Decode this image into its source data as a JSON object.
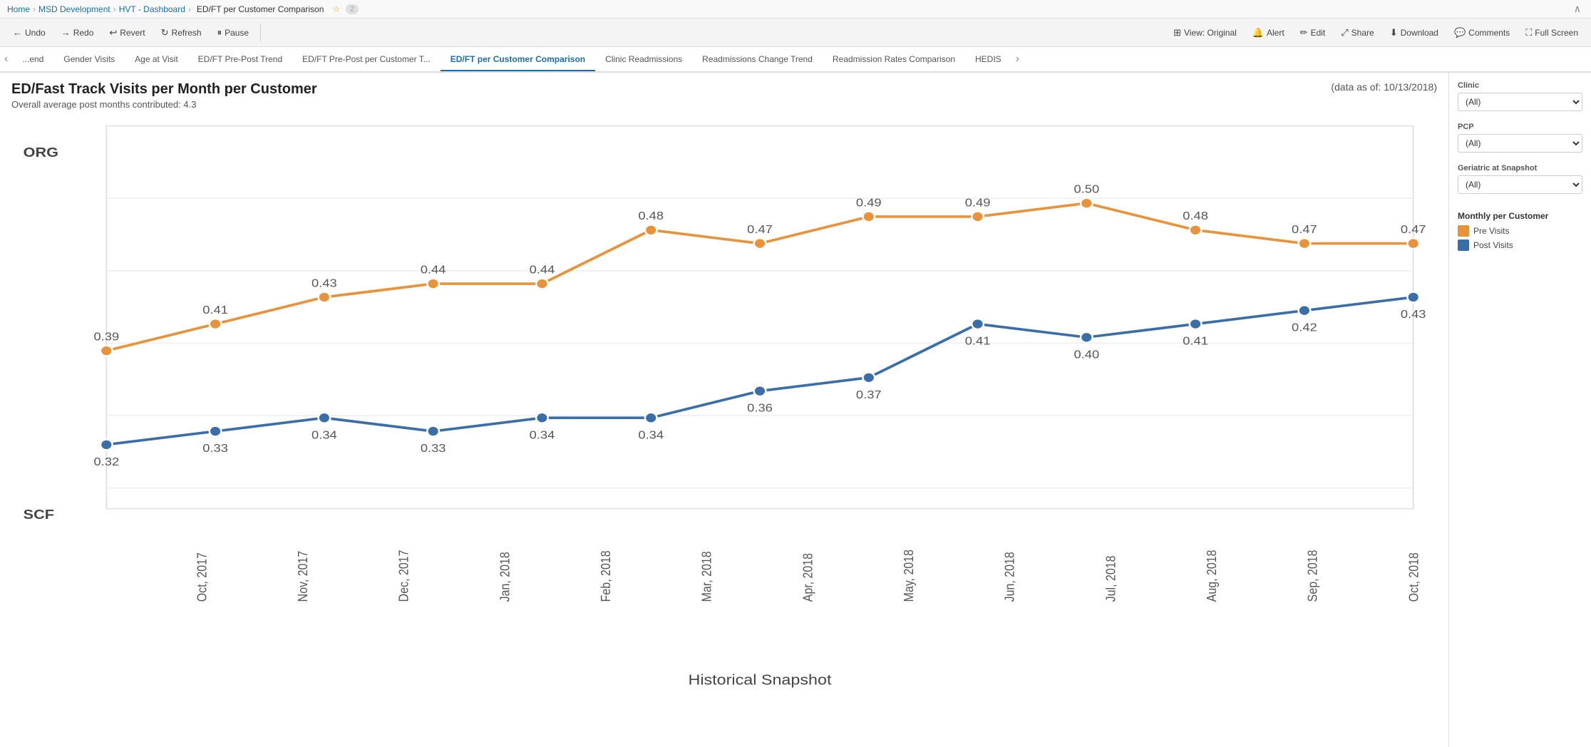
{
  "breadcrumb": {
    "home": "Home",
    "msd": "MSD Development",
    "hvt": "HVT - Dashboard",
    "current": "ED/FT per Customer Comparison",
    "count": "2"
  },
  "toolbar": {
    "undo_label": "Undo",
    "redo_label": "Redo",
    "revert_label": "Revert",
    "refresh_label": "Refresh",
    "pause_label": "Pause",
    "view_label": "View: Original",
    "alert_label": "Alert",
    "edit_label": "Edit",
    "share_label": "Share",
    "download_label": "Download",
    "comments_label": "Comments",
    "fullscreen_label": "Full Screen"
  },
  "tabs": [
    {
      "label": "...end",
      "active": false
    },
    {
      "label": "Gender Visits",
      "active": false
    },
    {
      "label": "Age at Visit",
      "active": false
    },
    {
      "label": "ED/FT Pre-Post Trend",
      "active": false
    },
    {
      "label": "ED/FT Pre-Post per Customer T...",
      "active": false
    },
    {
      "label": "ED/FT per Customer Comparison",
      "active": true
    },
    {
      "label": "Clinic Readmissions",
      "active": false
    },
    {
      "label": "Readmissions Change Trend",
      "active": false
    },
    {
      "label": "Readmission Rates Comparison",
      "active": false
    },
    {
      "label": "HEDIS",
      "active": false
    }
  ],
  "chart": {
    "title": "ED/Fast Track Visits per Month per Customer",
    "subtitle": "Overall average post months contributed: 4.3",
    "date_label": "(data as of: 10/13/2018)",
    "x_axis_label": "Historical Snapshot",
    "org_label": "ORG",
    "scf_label": "SCF",
    "months": [
      "Oct, 2017",
      "Nov, 2017",
      "Dec, 2017",
      "Jan, 2018",
      "Feb, 2018",
      "Mar, 2018",
      "Apr, 2018",
      "May, 2018",
      "Jun, 2018",
      "Jul, 2018",
      "Aug, 2018",
      "Sep, 2018",
      "Oct, 2018"
    ],
    "pre_visits": [
      0.39,
      0.41,
      0.43,
      0.44,
      0.44,
      0.48,
      0.47,
      0.49,
      0.49,
      0.5,
      0.48,
      0.47,
      0.47
    ],
    "post_visits": [
      0.32,
      0.33,
      0.34,
      0.33,
      0.34,
      0.34,
      0.36,
      0.37,
      0.41,
      0.4,
      0.41,
      0.42,
      0.43
    ],
    "pre_color": "#E8923A",
    "post_color": "#3A6EA8"
  },
  "sidebar": {
    "clinic_label": "Clinic",
    "clinic_value": "(All)",
    "pcp_label": "PCP",
    "pcp_value": "(All)",
    "geriatric_label": "Geriatric at Snapshot",
    "geriatric_value": "(All)",
    "legend_title": "Monthly per Customer",
    "pre_label": "Pre Visits",
    "post_label": "Post Visits"
  }
}
